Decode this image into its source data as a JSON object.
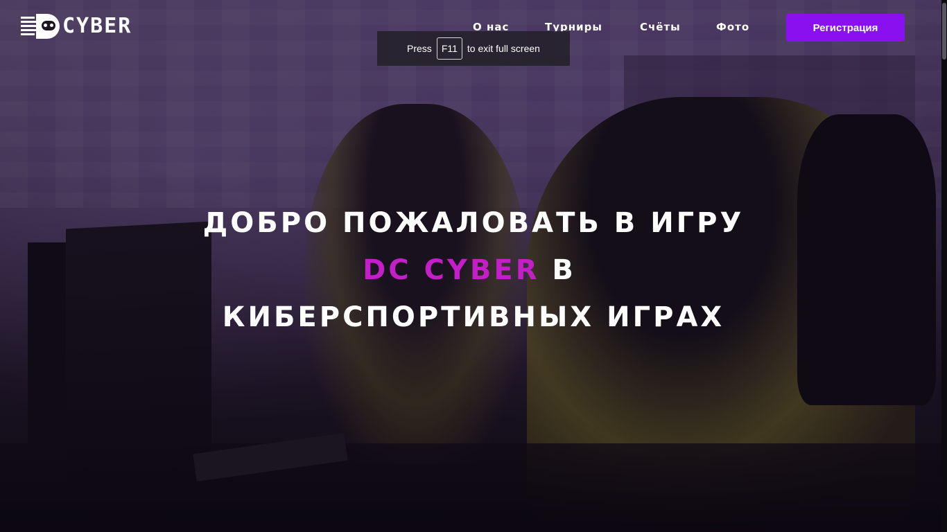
{
  "logo": {
    "text": "CYBER",
    "icon": "dc-logo-icon"
  },
  "nav": {
    "items": [
      {
        "label": "О нас"
      },
      {
        "label": "Турниры"
      },
      {
        "label": "Счёты"
      },
      {
        "label": "Фото"
      }
    ]
  },
  "header": {
    "register_label": "Регистрация"
  },
  "fullscreen_notice": {
    "press": "Press",
    "key": "F11",
    "rest": "to exit full screen"
  },
  "hero": {
    "line1": "ДОБРО ПОЖАЛОВАТЬ В ИГРУ",
    "brand": "DC CYBER",
    "line2_rest": " В",
    "line3": "КИБЕРСПОРТИВНЫХ ИГРАХ"
  },
  "colors": {
    "accent": "#8b10f0",
    "brand_text": "#c41ec8"
  }
}
